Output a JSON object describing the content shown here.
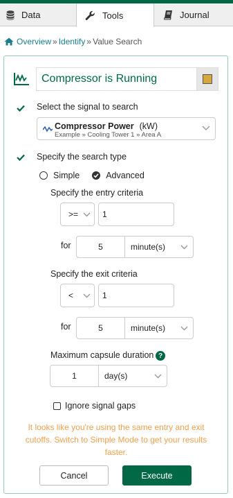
{
  "tabs": [
    {
      "label": "Data",
      "icon": "database-icon"
    },
    {
      "label": "Tools",
      "icon": "wrench-icon",
      "active": true
    },
    {
      "label": "Journal",
      "icon": "book-icon"
    }
  ],
  "breadcrumb": {
    "items": [
      "Overview",
      "Identify",
      "Value Search"
    ],
    "separator": "»"
  },
  "condition": {
    "name": "Compressor is Running",
    "color": "#d4a83c"
  },
  "steps": {
    "select_signal": "Select the signal to search",
    "search_type": "Specify the search type"
  },
  "signal": {
    "name": "Compressor Power",
    "unit": "(kW)",
    "path": "Example » Cooling Tower 1 » Area A"
  },
  "search_type": {
    "simple": "Simple",
    "advanced": "Advanced",
    "selected": "Advanced"
  },
  "entry": {
    "label": "Specify the entry criteria",
    "operator": ">=",
    "value": "1",
    "for_label": "for",
    "duration": "5",
    "unit": "minute(s)"
  },
  "exit": {
    "label": "Specify the exit criteria",
    "operator": "<",
    "value": "1",
    "for_label": "for",
    "duration": "5",
    "unit": "minute(s)"
  },
  "max_duration": {
    "label": "Maximum capsule duration",
    "help": "?",
    "value": "1",
    "unit": "day(s)"
  },
  "ignore_gaps": {
    "label": "Ignore signal gaps",
    "checked": false
  },
  "warning": "It looks like you're using the same entry and exit cutoffs. Switch to Simple Mode to get your results faster.",
  "buttons": {
    "cancel": "Cancel",
    "execute": "Execute"
  },
  "colors": {
    "brand": "#006845",
    "link": "#1a7d8e",
    "warning": "#f0a050"
  }
}
